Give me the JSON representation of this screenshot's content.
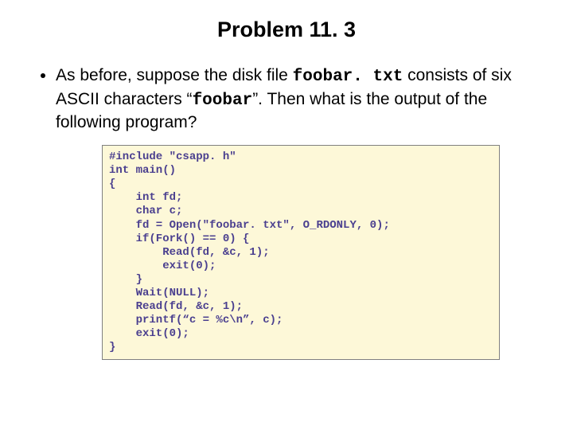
{
  "title": "Problem 11. 3",
  "bullet": {
    "pre1": "As before, suppose the disk file ",
    "file": "foobar. txt",
    "mid1": " consists of six ASCII characters “",
    "word": "foobar",
    "post1": "”.  Then what is the output of the following program?"
  },
  "code": "#include \"csapp. h\"\nint main()\n{\n    int fd;\n    char c;\n    fd = Open(\"foobar. txt\", O_RDONLY, 0);\n    if(Fork() == 0) {\n        Read(fd, &c, 1);\n        exit(0);\n    }\n    Wait(NULL);\n    Read(fd, &c, 1);\n    printf(“c = %c\\n”, c);\n    exit(0);\n}"
}
